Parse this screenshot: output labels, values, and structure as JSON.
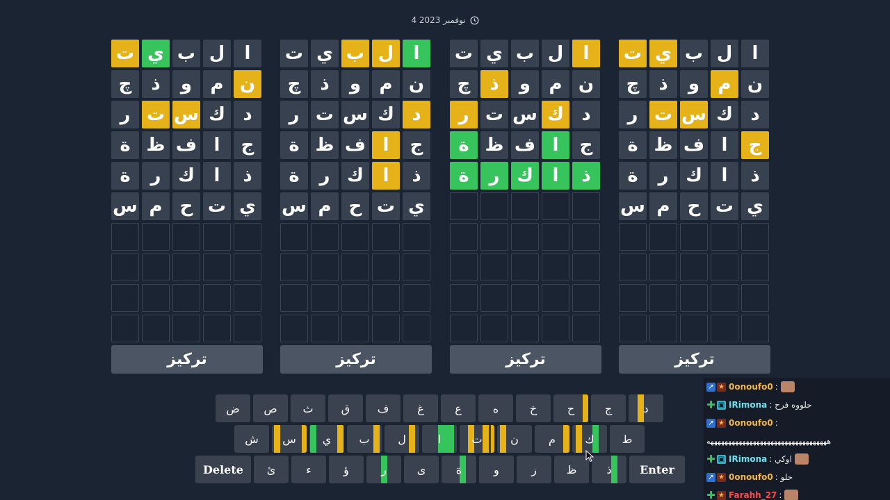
{
  "header": {
    "date": "4 نوفمبر 2023"
  },
  "boards": [
    {
      "rows": [
        [
          [
            "ت",
            "y"
          ],
          [
            "ي",
            "g"
          ],
          [
            "ب",
            "n"
          ],
          [
            "ل",
            "n"
          ],
          [
            "ا",
            "n"
          ]
        ],
        [
          [
            "چ",
            "n"
          ],
          [
            "ذ",
            "n"
          ],
          [
            "و",
            "n"
          ],
          [
            "م",
            "n"
          ],
          [
            "ن",
            "y"
          ]
        ],
        [
          [
            "ر",
            "n"
          ],
          [
            "ت",
            "y"
          ],
          [
            "س",
            "y"
          ],
          [
            "ك",
            "n"
          ],
          [
            "د",
            "n"
          ]
        ],
        [
          [
            "ة",
            "n"
          ],
          [
            "ظ",
            "n"
          ],
          [
            "ف",
            "n"
          ],
          [
            "ا",
            "n"
          ],
          [
            "ج",
            "n"
          ]
        ],
        [
          [
            "ة",
            "n"
          ],
          [
            "ر",
            "n"
          ],
          [
            "ك",
            "n"
          ],
          [
            "ا",
            "n"
          ],
          [
            "ذ",
            "n"
          ]
        ],
        [
          [
            "س",
            "n"
          ],
          [
            "م",
            "n"
          ],
          [
            "ح",
            "n"
          ],
          [
            "ت",
            "n"
          ],
          [
            "ي",
            "n"
          ]
        ],
        [
          [
            "",
            "e"
          ],
          [
            "",
            "e"
          ],
          [
            "",
            "e"
          ],
          [
            "",
            "e"
          ],
          [
            "",
            "e"
          ]
        ],
        [
          [
            "",
            "e"
          ],
          [
            "",
            "e"
          ],
          [
            "",
            "e"
          ],
          [
            "",
            "e"
          ],
          [
            "",
            "e"
          ]
        ],
        [
          [
            "",
            "e"
          ],
          [
            "",
            "e"
          ],
          [
            "",
            "e"
          ],
          [
            "",
            "e"
          ],
          [
            "",
            "e"
          ]
        ],
        [
          [
            "",
            "e"
          ],
          [
            "",
            "e"
          ],
          [
            "",
            "e"
          ],
          [
            "",
            "e"
          ],
          [
            "",
            "e"
          ]
        ]
      ],
      "focus_label": "تركيز"
    },
    {
      "rows": [
        [
          [
            "ت",
            "n"
          ],
          [
            "ي",
            "n"
          ],
          [
            "ب",
            "y"
          ],
          [
            "ل",
            "y"
          ],
          [
            "ا",
            "g"
          ]
        ],
        [
          [
            "چ",
            "n"
          ],
          [
            "ذ",
            "n"
          ],
          [
            "و",
            "n"
          ],
          [
            "م",
            "n"
          ],
          [
            "ن",
            "n"
          ]
        ],
        [
          [
            "ر",
            "n"
          ],
          [
            "ت",
            "n"
          ],
          [
            "س",
            "n"
          ],
          [
            "ك",
            "n"
          ],
          [
            "د",
            "y"
          ]
        ],
        [
          [
            "ة",
            "n"
          ],
          [
            "ظ",
            "n"
          ],
          [
            "ف",
            "n"
          ],
          [
            "ا",
            "y"
          ],
          [
            "ج",
            "n"
          ]
        ],
        [
          [
            "ة",
            "n"
          ],
          [
            "ر",
            "n"
          ],
          [
            "ك",
            "n"
          ],
          [
            "ا",
            "y"
          ],
          [
            "ذ",
            "n"
          ]
        ],
        [
          [
            "س",
            "n"
          ],
          [
            "م",
            "n"
          ],
          [
            "ح",
            "n"
          ],
          [
            "ت",
            "n"
          ],
          [
            "ي",
            "n"
          ]
        ],
        [
          [
            "",
            "e"
          ],
          [
            "",
            "e"
          ],
          [
            "",
            "e"
          ],
          [
            "",
            "e"
          ],
          [
            "",
            "e"
          ]
        ],
        [
          [
            "",
            "e"
          ],
          [
            "",
            "e"
          ],
          [
            "",
            "e"
          ],
          [
            "",
            "e"
          ],
          [
            "",
            "e"
          ]
        ],
        [
          [
            "",
            "e"
          ],
          [
            "",
            "e"
          ],
          [
            "",
            "e"
          ],
          [
            "",
            "e"
          ],
          [
            "",
            "e"
          ]
        ],
        [
          [
            "",
            "e"
          ],
          [
            "",
            "e"
          ],
          [
            "",
            "e"
          ],
          [
            "",
            "e"
          ],
          [
            "",
            "e"
          ]
        ]
      ],
      "focus_label": "تركيز"
    },
    {
      "rows": [
        [
          [
            "ت",
            "n"
          ],
          [
            "ي",
            "n"
          ],
          [
            "ب",
            "n"
          ],
          [
            "ل",
            "n"
          ],
          [
            "ا",
            "y"
          ]
        ],
        [
          [
            "چ",
            "n"
          ],
          [
            "ذ",
            "y"
          ],
          [
            "و",
            "n"
          ],
          [
            "م",
            "n"
          ],
          [
            "ن",
            "n"
          ]
        ],
        [
          [
            "ر",
            "y"
          ],
          [
            "ت",
            "n"
          ],
          [
            "س",
            "n"
          ],
          [
            "ك",
            "y"
          ],
          [
            "د",
            "n"
          ]
        ],
        [
          [
            "ة",
            "g"
          ],
          [
            "ظ",
            "n"
          ],
          [
            "ف",
            "n"
          ],
          [
            "ا",
            "g"
          ],
          [
            "ج",
            "n"
          ]
        ],
        [
          [
            "ة",
            "g"
          ],
          [
            "ر",
            "g"
          ],
          [
            "ك",
            "g"
          ],
          [
            "ا",
            "g"
          ],
          [
            "ذ",
            "g"
          ]
        ],
        [
          [
            "",
            "e"
          ],
          [
            "",
            "e"
          ],
          [
            "",
            "e"
          ],
          [
            "",
            "e"
          ],
          [
            "",
            "e"
          ]
        ],
        [
          [
            "",
            "e"
          ],
          [
            "",
            "e"
          ],
          [
            "",
            "e"
          ],
          [
            "",
            "e"
          ],
          [
            "",
            "e"
          ]
        ],
        [
          [
            "",
            "e"
          ],
          [
            "",
            "e"
          ],
          [
            "",
            "e"
          ],
          [
            "",
            "e"
          ],
          [
            "",
            "e"
          ]
        ],
        [
          [
            "",
            "e"
          ],
          [
            "",
            "e"
          ],
          [
            "",
            "e"
          ],
          [
            "",
            "e"
          ],
          [
            "",
            "e"
          ]
        ],
        [
          [
            "",
            "e"
          ],
          [
            "",
            "e"
          ],
          [
            "",
            "e"
          ],
          [
            "",
            "e"
          ],
          [
            "",
            "e"
          ]
        ]
      ],
      "focus_label": "تركيز"
    },
    {
      "rows": [
        [
          [
            "ت",
            "y"
          ],
          [
            "ي",
            "y"
          ],
          [
            "ب",
            "n"
          ],
          [
            "ل",
            "n"
          ],
          [
            "ا",
            "n"
          ]
        ],
        [
          [
            "چ",
            "n"
          ],
          [
            "ذ",
            "n"
          ],
          [
            "و",
            "n"
          ],
          [
            "م",
            "y"
          ],
          [
            "ن",
            "n"
          ]
        ],
        [
          [
            "ر",
            "n"
          ],
          [
            "ت",
            "y"
          ],
          [
            "س",
            "y"
          ],
          [
            "ك",
            "n"
          ],
          [
            "د",
            "n"
          ]
        ],
        [
          [
            "ة",
            "n"
          ],
          [
            "ظ",
            "n"
          ],
          [
            "ف",
            "n"
          ],
          [
            "ا",
            "n"
          ],
          [
            "ج",
            "y"
          ]
        ],
        [
          [
            "ة",
            "n"
          ],
          [
            "ر",
            "n"
          ],
          [
            "ك",
            "n"
          ],
          [
            "ا",
            "n"
          ],
          [
            "ذ",
            "n"
          ]
        ],
        [
          [
            "س",
            "n"
          ],
          [
            "م",
            "n"
          ],
          [
            "ح",
            "n"
          ],
          [
            "ت",
            "n"
          ],
          [
            "ي",
            "n"
          ]
        ],
        [
          [
            "",
            "e"
          ],
          [
            "",
            "e"
          ],
          [
            "",
            "e"
          ],
          [
            "",
            "e"
          ],
          [
            "",
            "e"
          ]
        ],
        [
          [
            "",
            "e"
          ],
          [
            "",
            "e"
          ],
          [
            "",
            "e"
          ],
          [
            "",
            "e"
          ],
          [
            "",
            "e"
          ]
        ],
        [
          [
            "",
            "e"
          ],
          [
            "",
            "e"
          ],
          [
            "",
            "e"
          ],
          [
            "",
            "e"
          ],
          [
            "",
            "e"
          ]
        ],
        [
          [
            "",
            "e"
          ],
          [
            "",
            "e"
          ],
          [
            "",
            "e"
          ],
          [
            "",
            "e"
          ],
          [
            "",
            "e"
          ]
        ]
      ],
      "focus_label": "تركيز"
    }
  ],
  "keyboard": {
    "row1": [
      {
        "k": "ض",
        "m": []
      },
      {
        "k": "ص",
        "m": []
      },
      {
        "k": "ث",
        "m": []
      },
      {
        "k": "ق",
        "m": []
      },
      {
        "k": "ف",
        "m": []
      },
      {
        "k": "غ",
        "m": []
      },
      {
        "k": "ع",
        "m": []
      },
      {
        "k": "ه",
        "m": []
      },
      {
        "k": "خ",
        "m": []
      },
      {
        "k": "ح",
        "m": [
          [
            "y",
            0.84,
            0.18
          ]
        ]
      },
      {
        "k": "ج",
        "m": []
      },
      {
        "k": "د",
        "m": [
          [
            "y",
            0.26,
            0.18
          ]
        ]
      }
    ],
    "row2": [
      {
        "k": "ش",
        "m": []
      },
      {
        "k": "س",
        "m": [
          [
            "y",
            0.06,
            0.18
          ],
          [
            "y",
            0.85,
            0.15
          ]
        ]
      },
      {
        "k": "ي",
        "m": [
          [
            "g",
            0.02,
            0.18
          ],
          [
            "y",
            0.8,
            0.18
          ]
        ]
      },
      {
        "k": "ب",
        "m": [
          [
            "y",
            0.76,
            0.18
          ]
        ]
      },
      {
        "k": "ل",
        "m": [
          [
            "y",
            0.7,
            0.18
          ]
        ]
      },
      {
        "k": "ا",
        "m": [
          [
            "g",
            0.46,
            0.46
          ]
        ]
      },
      {
        "k": "ت",
        "m": [
          [
            "y",
            0.24,
            0.18
          ],
          [
            "y",
            0.66,
            0.18
          ],
          [
            "y",
            0.9,
            0.12
          ]
        ]
      },
      {
        "k": "ن",
        "m": [
          [
            "y",
            0.08,
            0.18
          ]
        ]
      },
      {
        "k": "م",
        "m": [
          [
            "y",
            0.82,
            0.18
          ]
        ]
      },
      {
        "k": "ك",
        "m": [
          [
            "y",
            0.1,
            0.18
          ],
          [
            "g",
            0.58,
            0.18
          ]
        ]
      },
      {
        "k": "ط",
        "m": []
      }
    ],
    "row3": [
      {
        "k": "ئ",
        "m": []
      },
      {
        "k": "ء",
        "m": []
      },
      {
        "k": "ؤ",
        "m": []
      },
      {
        "k": "ر",
        "m": [
          [
            "g",
            0.42,
            0.18
          ]
        ]
      },
      {
        "k": "ى",
        "m": []
      },
      {
        "k": "ة",
        "m": [
          [
            "g",
            0.52,
            0.18
          ]
        ]
      },
      {
        "k": "و",
        "m": []
      },
      {
        "k": "ز",
        "m": []
      },
      {
        "k": "ظ",
        "m": []
      },
      {
        "k": "ذ",
        "m": [
          [
            "g",
            0.56,
            0.18
          ]
        ]
      }
    ],
    "delete_label": "Delete",
    "enter_label": "Enter",
    "colors": {
      "y": "#e6b21a",
      "g": "#37c45c"
    }
  },
  "chat": [
    {
      "user": "0onoufo0",
      "color": "#f1b64a",
      "badge1": "blue",
      "badge2": "star",
      "text": ":",
      "emote": true,
      "arrow": "↗"
    },
    {
      "user": "IRimona",
      "color": "#6fe0ee",
      "badge1": "green",
      "badge2": "game",
      "text": ": حلووه فرح",
      "emote": false,
      "arrow": "✚"
    },
    {
      "user": "0onoufo0",
      "color": "#f1b64a",
      "badge1": "blue",
      "badge2": "star",
      "text": ":",
      "emote": false,
      "arrow": "↗"
    },
    {
      "rule": "ههههههههههههههههههههههههههههههههههه"
    },
    {
      "user": "IRimona",
      "color": "#6fe0ee",
      "badge1": "green",
      "badge2": "game",
      "text": ": اوكي",
      "emote": true,
      "arrow": "✚"
    },
    {
      "user": "0onoufo0",
      "color": "#f1b64a",
      "badge1": "blue",
      "badge2": "star",
      "text": ": حلو",
      "emote": false,
      "arrow": "↗"
    },
    {
      "user": "Farahh_27",
      "color": "#ff4a4a",
      "badge1": "green",
      "badge2": "star",
      "text": ":",
      "emote": true,
      "arrow": "✚"
    }
  ]
}
